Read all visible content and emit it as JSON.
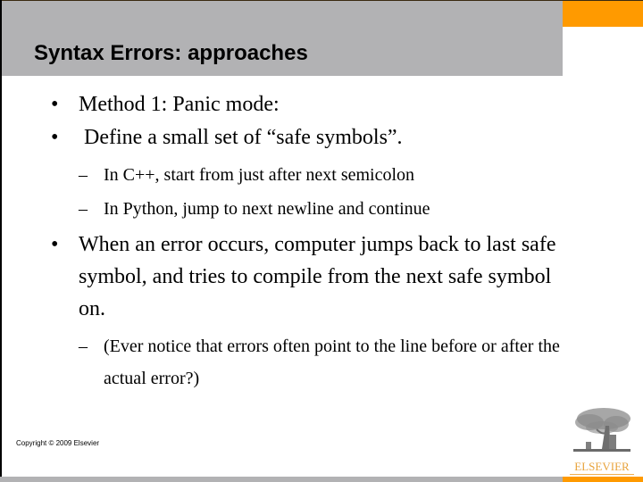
{
  "slide": {
    "title": "Syntax Errors: approaches",
    "bullets": [
      {
        "level": 1,
        "marker": "•",
        "text": "Method 1: Panic mode:"
      },
      {
        "level": 1,
        "marker": "•",
        "text": " Define a small set of “safe symbols”."
      },
      {
        "level": 2,
        "marker": "–",
        "text": "In C++, start from just after next semicolon"
      },
      {
        "level": 2,
        "marker": "–",
        "text": "In Python, jump to next newline and continue"
      },
      {
        "level": 1,
        "marker": "•",
        "text": "When an error occurs, computer jumps back to last safe symbol, and tries to compile from the next safe symbol on."
      },
      {
        "level": 2,
        "marker": "–",
        "text": "(Ever notice that errors often point to the line before or after the actual error?)"
      }
    ],
    "footer": {
      "copyright": "Copyright © 2009 Elsevier",
      "logo_text": "ELSEVIER",
      "logo_icon": "elsevier-tree-icon"
    }
  },
  "colors": {
    "header_gray": "#b2b2b4",
    "accent_orange": "#ff9a00",
    "logo_orange": "#e8a33c"
  }
}
